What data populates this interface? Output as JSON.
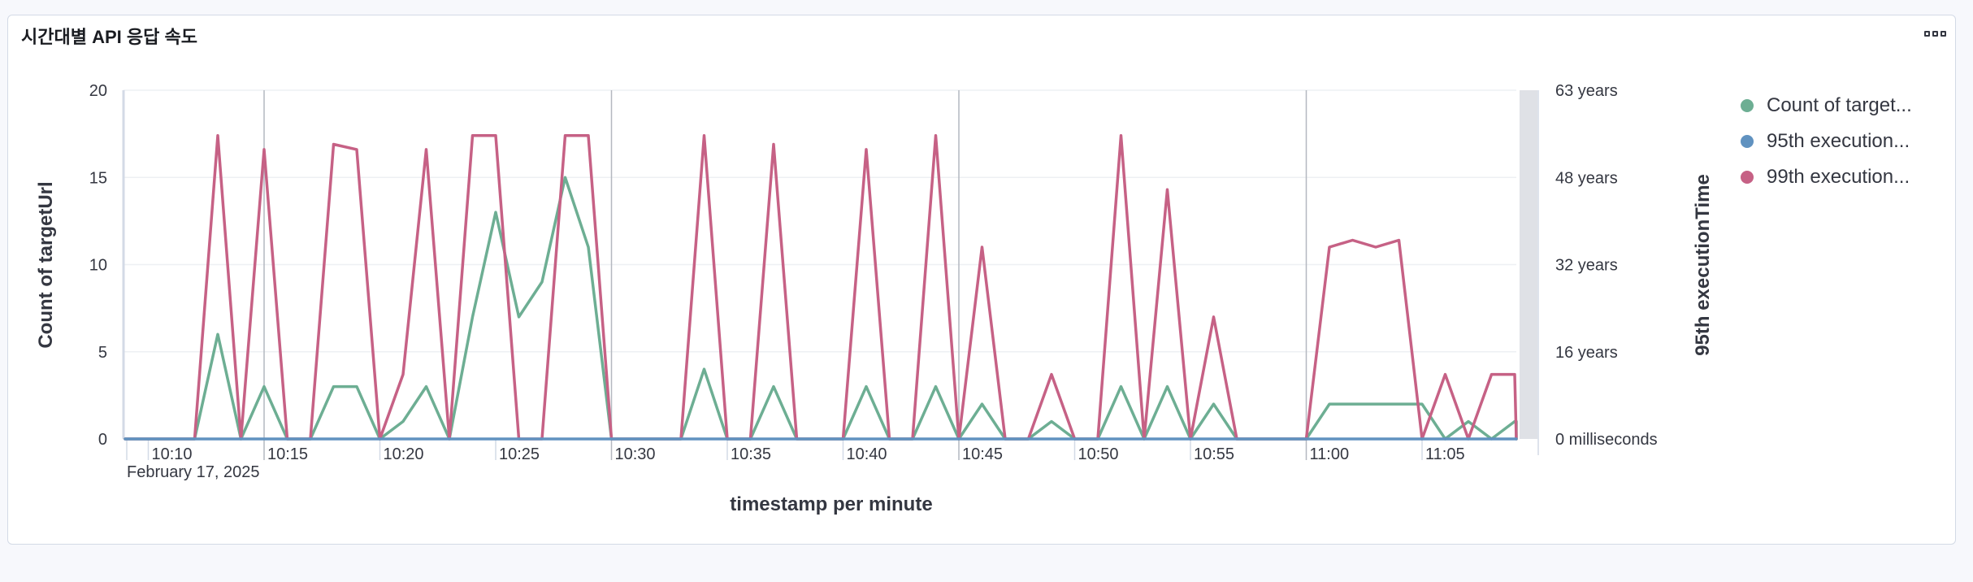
{
  "panel": {
    "title": "시간대별 API 응답 속도",
    "options_icon": "options-icon"
  },
  "colors": {
    "count": "#6dae93",
    "p95": "#6092c0",
    "p99": "#c66185",
    "grid": "#eef0f3",
    "axis": "#98a2b3",
    "text": "#343741"
  },
  "chart_data": {
    "type": "line",
    "xlabel": "timestamp per minute",
    "ylabel": "Count of targetUrl",
    "ylabel_right": "95th executionTime",
    "x_date_label": "February 17, 2025",
    "x_ticks": [
      "10:10",
      "10:15",
      "10:20",
      "10:25",
      "10:30",
      "10:35",
      "10:40",
      "10:45",
      "10:50",
      "10:55",
      "11:00",
      "11:05"
    ],
    "y_ticks": [
      "0",
      "5",
      "10",
      "15",
      "20"
    ],
    "y_right_ticks": [
      "0 milliseconds",
      "16 years",
      "32 years",
      "48 years",
      "63 years"
    ],
    "ylim": [
      0,
      20
    ],
    "x_start": "10:09",
    "minute_count": 61,
    "grid": true,
    "legend_position": "right",
    "legend": [
      "Count of target...",
      "95th execution...",
      "99th execution..."
    ],
    "series": [
      {
        "name": "Count of targetUrl",
        "axis": "left",
        "values": [
          0,
          0,
          0,
          0,
          6,
          0,
          3,
          0,
          0,
          3,
          3,
          0,
          1,
          3,
          0,
          7,
          13,
          7,
          9,
          15,
          11,
          0,
          0,
          0,
          0,
          4,
          0,
          0,
          3,
          0,
          0,
          0,
          3,
          0,
          0,
          3,
          0,
          2,
          0,
          0,
          1,
          0,
          0,
          3,
          0,
          3,
          0,
          2,
          0,
          0,
          0,
          0,
          2,
          2,
          2,
          2,
          2,
          0,
          1,
          0,
          1,
          1,
          0
        ]
      },
      {
        "name": "95th executionTime",
        "axis": "right",
        "values": [
          0,
          0,
          0,
          0,
          0,
          0,
          0,
          0,
          0,
          0,
          0,
          0,
          0,
          0,
          0,
          0,
          0,
          0,
          0,
          0,
          0,
          0,
          0,
          0,
          0,
          0,
          0,
          0,
          0,
          0,
          0,
          0,
          0,
          0,
          0,
          0,
          0,
          0,
          0,
          0,
          0,
          0,
          0,
          0,
          0,
          0,
          0,
          0,
          0,
          0,
          0,
          0,
          0,
          0,
          0,
          0,
          0,
          0,
          0,
          0,
          0,
          0,
          0
        ]
      },
      {
        "name": "99th executionTime",
        "axis": "left_scaled",
        "values": [
          0,
          0,
          0,
          0,
          17.4,
          0,
          16.6,
          0,
          0,
          16.9,
          16.6,
          0,
          3.7,
          16.6,
          0,
          17.4,
          17.4,
          0,
          0,
          17.4,
          17.4,
          0,
          0,
          0,
          0,
          17.4,
          0,
          0,
          16.9,
          0,
          0,
          0,
          16.6,
          0,
          0,
          17.4,
          0,
          11.0,
          0,
          0,
          3.7,
          0,
          0,
          17.4,
          0,
          14.3,
          0,
          7.0,
          0,
          0,
          0,
          0,
          11.0,
          11.4,
          11.0,
          11.4,
          0,
          3.7,
          0,
          3.7,
          3.7,
          0
        ]
      }
    ]
  }
}
